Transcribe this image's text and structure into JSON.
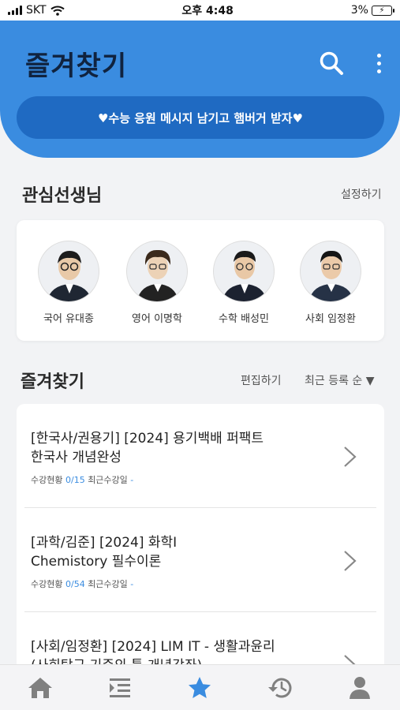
{
  "status_bar": {
    "carrier": "SKT",
    "time": "오후 4:48",
    "battery": "3%"
  },
  "header": {
    "title": "즐겨찾기",
    "icons": [
      "search-icon",
      "more-vertical-icon"
    ],
    "banner_text": "♥수능 응원 메시지 남기고 햄버거 받자♥"
  },
  "colors": {
    "accent": "#3a8ce0",
    "banner": "#1f6ac2",
    "header_text": "#10233f"
  },
  "teachers_section": {
    "title": "관심선생님",
    "settings_label": "설정하기",
    "teachers": [
      {
        "name": "국어 유대종"
      },
      {
        "name": "영어 이명학"
      },
      {
        "name": "수학 배성민"
      },
      {
        "name": "사회 임정환"
      }
    ]
  },
  "favorites_section": {
    "title": "즐겨찾기",
    "edit_label": "편집하기",
    "sort_label": "최근 등록 순 ▼",
    "courses": [
      {
        "title_line1": "[한국사/권용기] [2024] 용기백배 퍼팩트",
        "title_line2": "한국사 개념완성",
        "progress_label": "수강현황",
        "progress_value": "0/15",
        "recent_label": "최근수강일",
        "recent_value": "-"
      },
      {
        "title_line1": "[과학/김준] [2024] 화학I",
        "title_line2": "Chemistory 필수이론",
        "progress_label": "수강현황",
        "progress_value": "0/54",
        "recent_label": "최근수강일",
        "recent_value": "-"
      },
      {
        "title_line1": "[사회/임정환] [2024] LIM IT - 생활과윤리",
        "title_line2": "(사회탐구 기준의 틀 개념강좌)"
      }
    ]
  },
  "tab_bar": {
    "tabs": [
      "home-icon",
      "list-indent-icon",
      "star-icon",
      "history-icon",
      "person-icon"
    ],
    "active": "star-icon"
  }
}
